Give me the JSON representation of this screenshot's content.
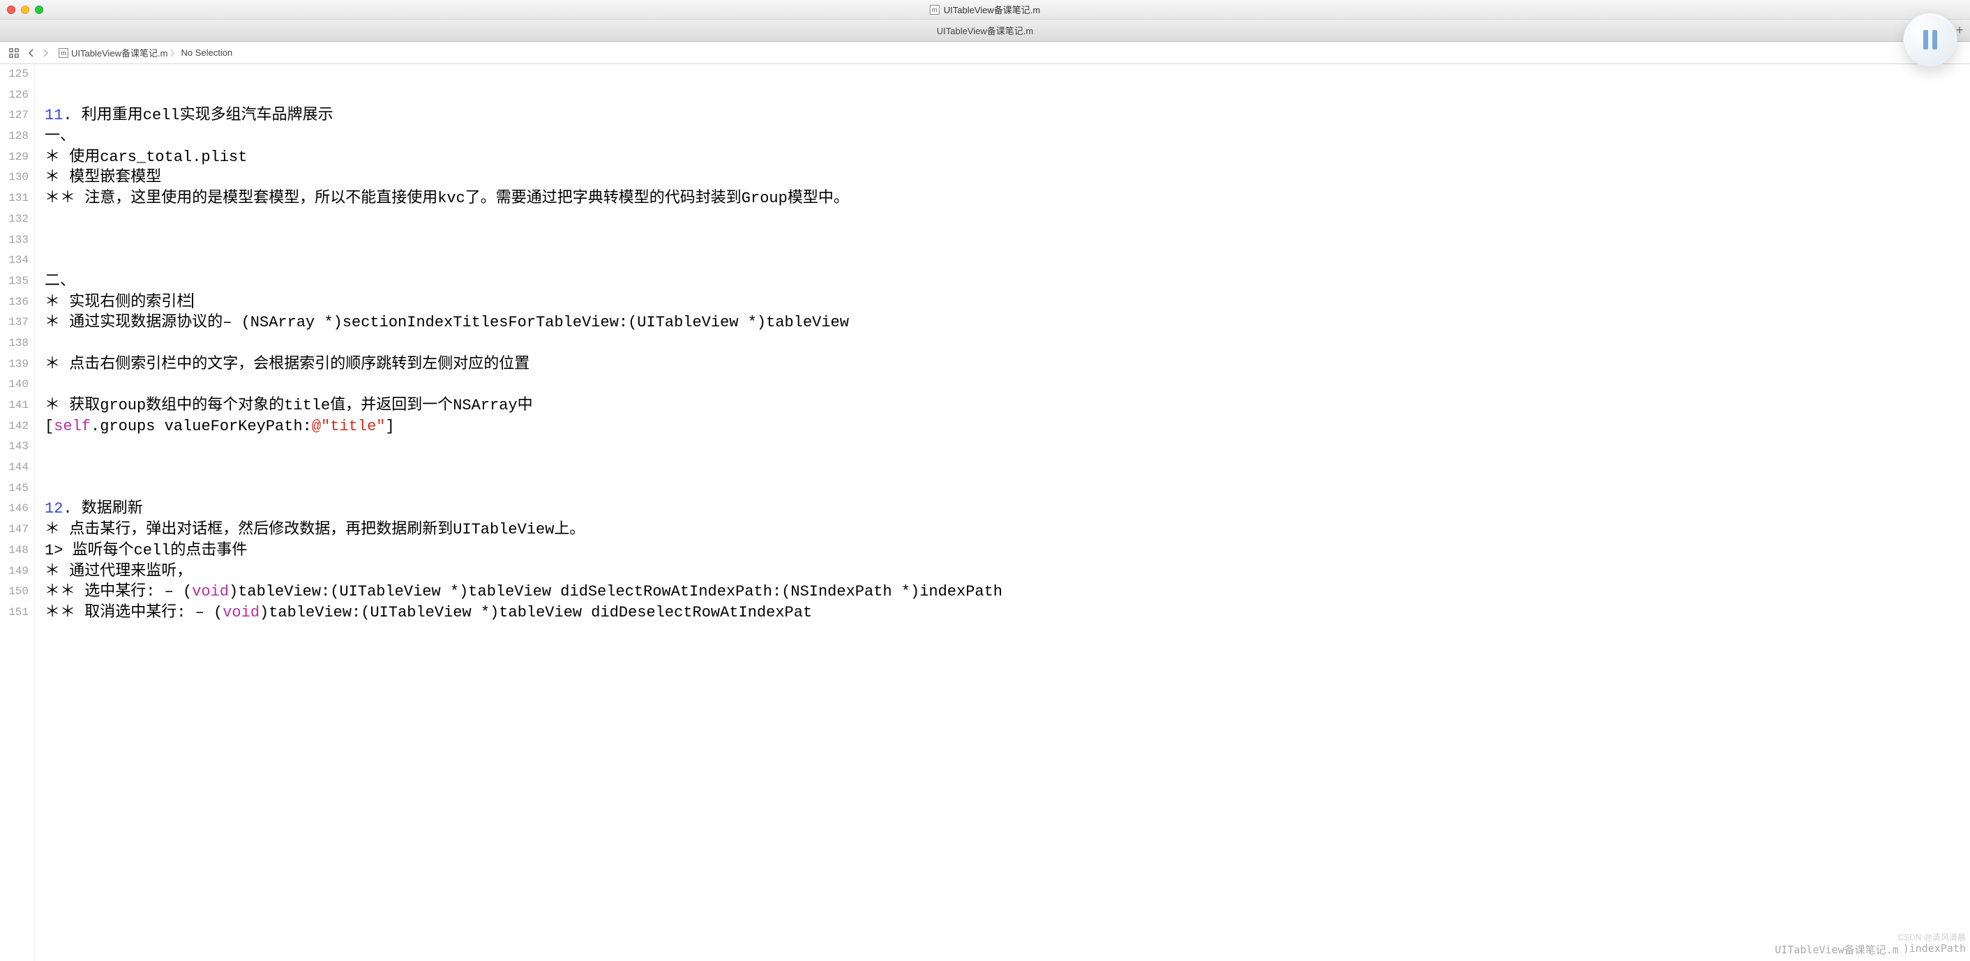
{
  "window": {
    "title": "UITableView备课笔记.m"
  },
  "tab": {
    "title": "UITableView备课笔记.m",
    "addLabel": "+"
  },
  "breadcrumb": {
    "file": "UITableView备课笔记.m",
    "selection": "No Selection"
  },
  "gutter": {
    "start": 125,
    "end": 151
  },
  "code": {
    "lines": [
      "",
      "",
      "11. 利用重用cell实现多组汽车品牌展示",
      "一、",
      "＊ 使用cars_total.plist",
      "＊ 模型嵌套模型",
      "＊＊ 注意，这里使用的是模型套模型，所以不能直接使用kvc了。需要通过把字典转模型的代码封装到Group模型中。",
      "",
      "",
      "",
      "二、",
      "＊ 实现右侧的索引栏|",
      "＊ 通过实现数据源协议的– (NSArray *)sectionIndexTitlesForTableView:(UITableView *)tableView",
      "",
      "＊ 点击右侧索引栏中的文字，会根据索引的顺序跳转到左侧对应的位置",
      "",
      "＊ 获取group数组中的每个对象的title值，并返回到一个NSArray中",
      "[self.groups valueForKeyPath:@\"title\"]",
      "",
      "",
      "",
      "12. 数据刷新",
      "＊ 点击某行，弹出对话框，然后修改数据，再把数据刷新到UITableView上。",
      "1> 监听每个cell的点击事件",
      "＊ 通过代理来监听，",
      "＊＊ 选中某行: – (void)tableView:(UITableView *)tableView didSelectRowAtIndexPath:(NSIndexPath *)indexPath",
      "＊＊ 取消选中某行: – (void)tableView:(UITableView *)tableView didDeselectRowAtIndexPat"
    ]
  },
  "statusRight": {
    "file": "UITableView备课笔记.m",
    "method": ")indexPath"
  },
  "watermark": "CSDN @清风清晨"
}
